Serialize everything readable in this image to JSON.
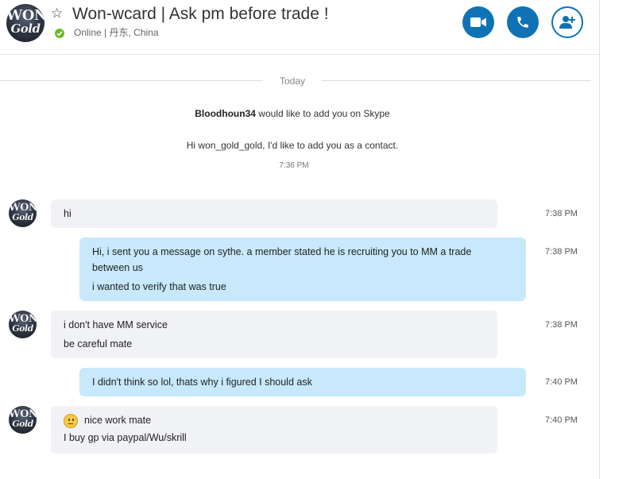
{
  "contact": {
    "name": "Won-wcard | Ask pm before trade !",
    "status": "Online",
    "location_separator": "|",
    "location": "丹东, China",
    "avatar_text_top": "WON",
    "avatar_text_bottom": "Gold"
  },
  "header_actions": {
    "video_icon": "video-camera-icon",
    "call_icon": "phone-icon",
    "add_icon": "add-contact-icon"
  },
  "day_separator": "Today",
  "contact_request": {
    "requester": "Bloodhoun34",
    "request_text": " would like to add you on Skype",
    "message": "Hi won_gold_gold, I'd like to add you as a contact.",
    "time": "7:36 PM"
  },
  "messages": [
    {
      "direction": "in",
      "lines": [
        "hi"
      ],
      "time": "7:38 PM"
    },
    {
      "direction": "out",
      "lines": [
        "Hi, i sent you a message on sythe. a member stated he is recruiting you to MM a trade",
        "between us",
        "i wanted to verify that was true"
      ],
      "time": "7:38 PM"
    },
    {
      "direction": "in",
      "lines": [
        "i don't have MM service",
        "be careful mate"
      ],
      "time": "7:38 PM"
    },
    {
      "direction": "out",
      "lines": [
        "I didn't think so lol, thats why i figured I should ask"
      ],
      "time": "7:40 PM"
    },
    {
      "direction": "in",
      "lines": [
        "nice work mate",
        "I buy gp via paypal/Wu/skrill"
      ],
      "time": "7:40 PM",
      "emoji": "smiley-icon"
    }
  ],
  "colors": {
    "accent": "#0f72b5",
    "online": "#6cbb2a",
    "incoming_bubble": "#f1f2f5",
    "outgoing_bubble": "#c7e9fb"
  }
}
